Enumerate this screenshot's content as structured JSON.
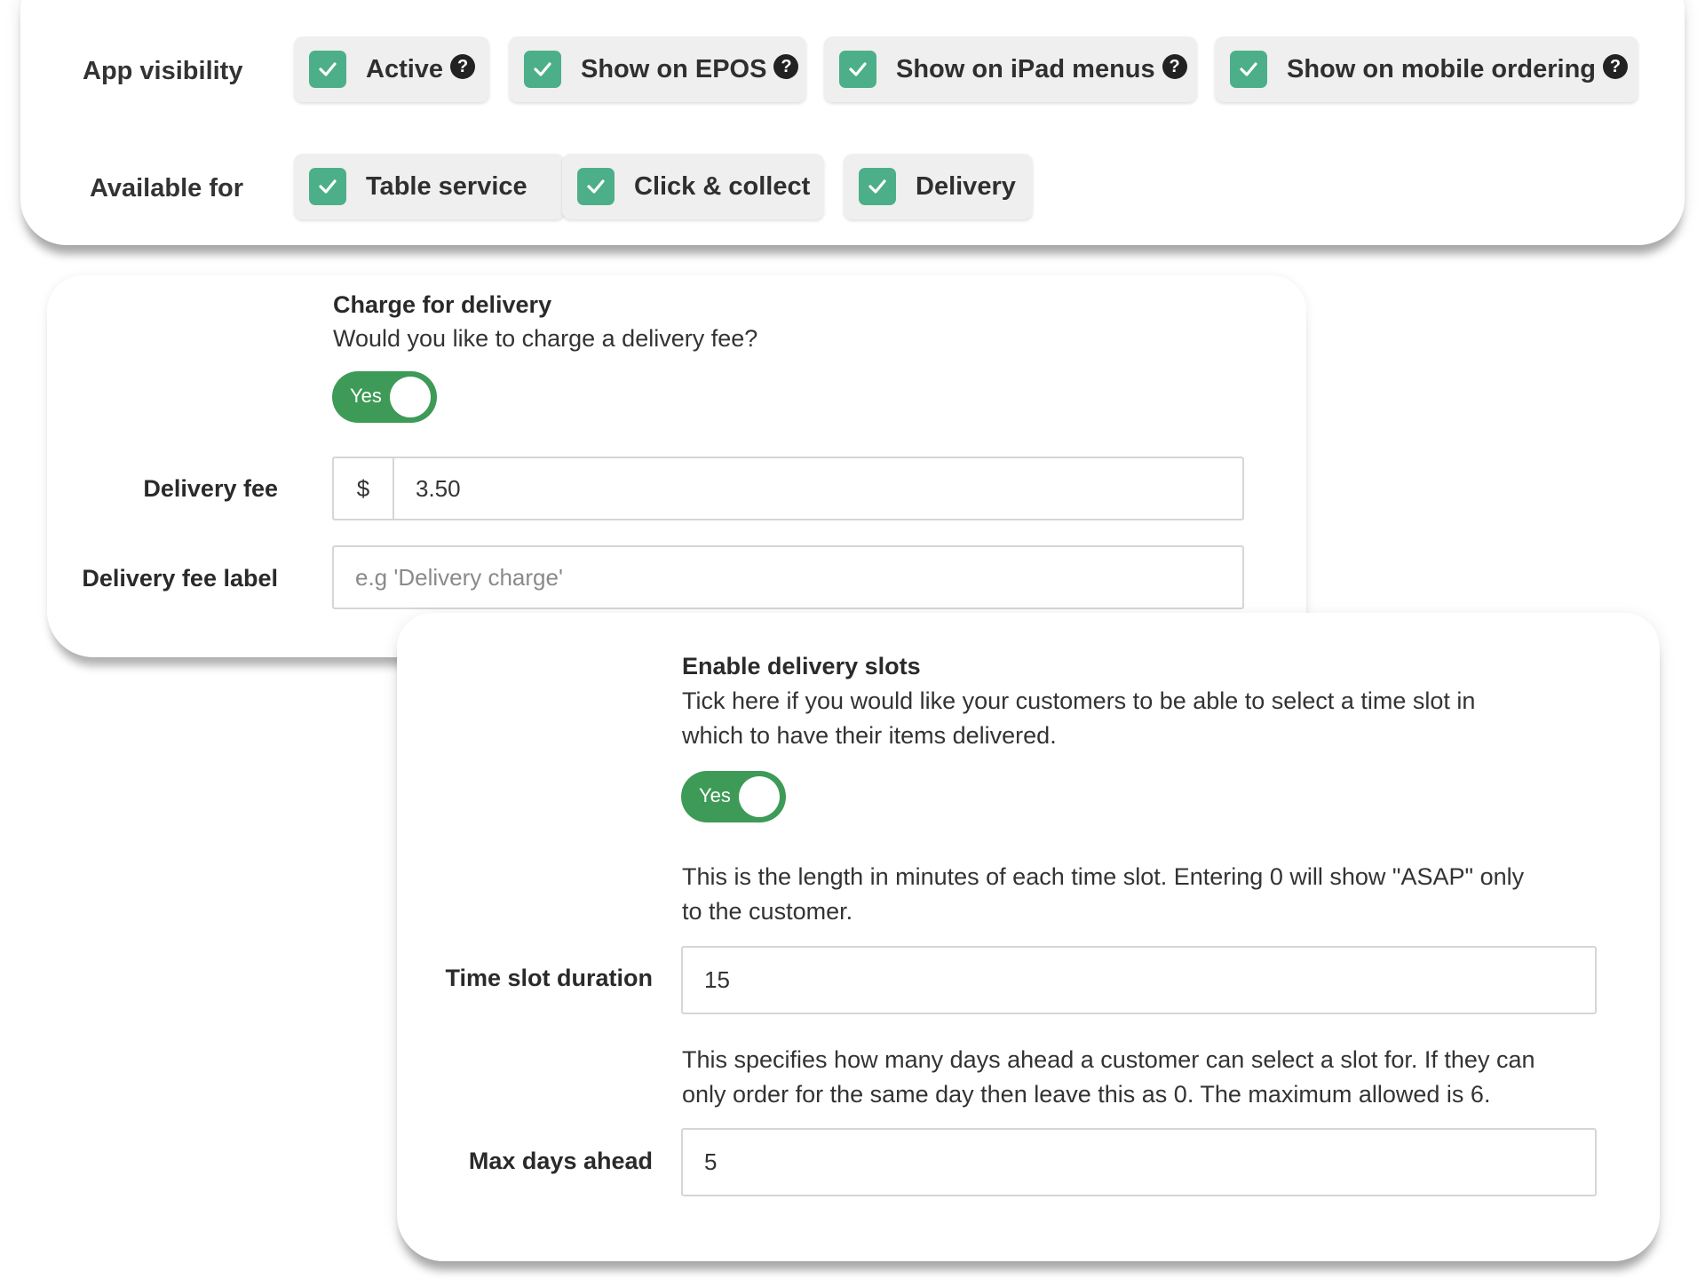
{
  "visibility": {
    "label": "App visibility",
    "options": [
      {
        "label": "Active",
        "checked": true,
        "help": "?"
      },
      {
        "label": "Show on EPOS",
        "checked": true,
        "help": "?"
      },
      {
        "label": "Show on iPad menus",
        "checked": true,
        "help": "?"
      },
      {
        "label": "Show on mobile ordering",
        "checked": true,
        "help": "?"
      }
    ]
  },
  "available": {
    "label": "Available for",
    "options": [
      {
        "label": "Table service",
        "checked": true
      },
      {
        "label": "Click & collect",
        "checked": true
      },
      {
        "label": "Delivery",
        "checked": true
      }
    ]
  },
  "delivery_charge": {
    "title": "Charge for delivery",
    "description": "Would you like to charge a delivery fee?",
    "toggle_label": "Yes",
    "fee_label": "Delivery fee",
    "currency": "$",
    "fee_value": "3.50",
    "fee_label_label": "Delivery fee label",
    "fee_label_placeholder": "e.g 'Delivery charge'"
  },
  "delivery_slots": {
    "title": "Enable delivery slots",
    "description_line1": "Tick here if you would like your customers to be able to select a time slot in",
    "description_line2": "which to have their items delivered.",
    "toggle_label": "Yes",
    "duration_help_line1": "This is the length in minutes of each time slot. Entering 0 will show \"ASAP\" only",
    "duration_help_line2": "to the customer.",
    "duration_label": "Time slot duration",
    "duration_value": "15",
    "days_help_line1": "This specifies how many days ahead a customer can select a slot for. If they can",
    "days_help_line2": "only order for the same day then leave this as 0. The maximum allowed is 6.",
    "days_label": "Max days ahead",
    "days_value": "5"
  },
  "colors": {
    "checkbox": "#4caf89",
    "toggle_on": "#3e9a57",
    "chip_bg": "#efefef"
  },
  "icons": {
    "checkbox": "checkmark-icon",
    "help": "question-circle-icon"
  }
}
